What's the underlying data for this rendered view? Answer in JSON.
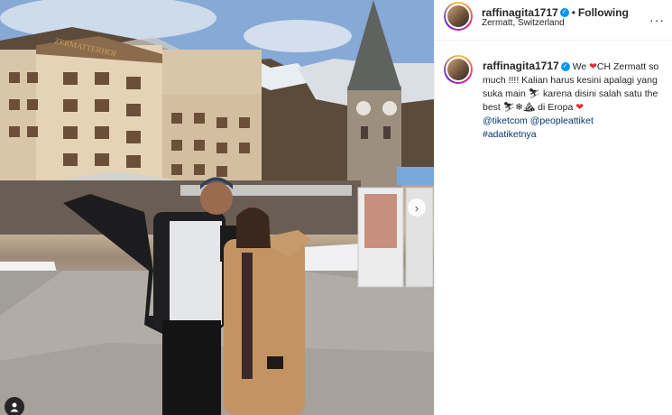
{
  "post": {
    "username": "raffinagita1717",
    "follow_status": "Following",
    "separator": "•",
    "location": "Zermatt, Switzerland",
    "more_icon": "···",
    "hotel_sign": "ZERMATTERHOF"
  },
  "caption": {
    "username": "raffinagita1717",
    "part1": "We",
    "heart_icon": "❤",
    "part2": "CH Zermatt so much !!!! Kalian harus kesini apalagi yang suka main",
    "ski_icon": "⛷",
    "part3": "karena disini salah satu the best",
    "snow_icons": "⛷❄⛰",
    "part4": "di Eropa",
    "heart_icon_2": "❤",
    "mention1": "@tiketcom",
    "mention2": "@peopleattiket",
    "hashtag": "#adatiketnya"
  },
  "colors": {
    "link": "#00376b",
    "verified": "#0095f6",
    "heart": "#ed2b3a"
  }
}
